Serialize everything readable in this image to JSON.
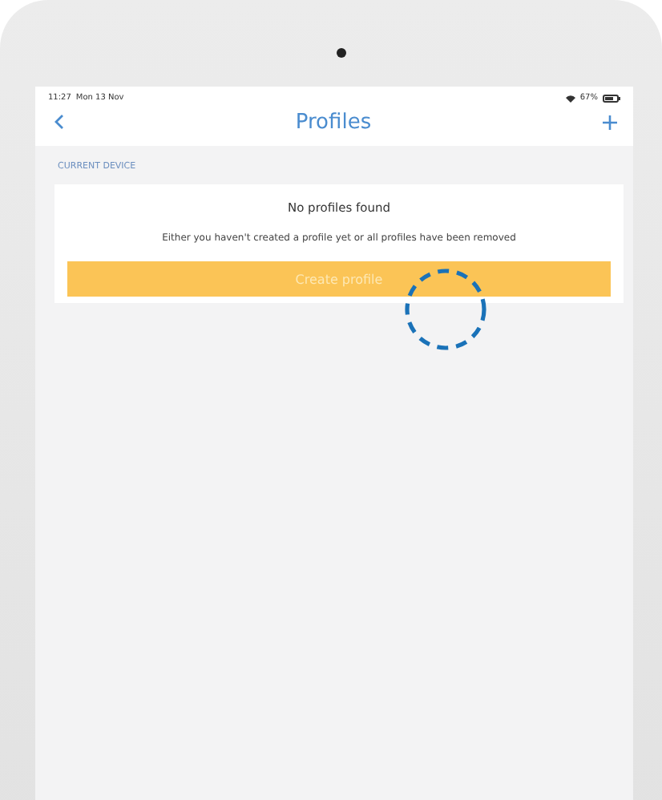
{
  "status_bar": {
    "time": "11:27",
    "date": "Mon 13 Nov",
    "battery": "67%"
  },
  "nav_bar": {
    "title": "Profiles"
  },
  "section_label": "CURRENT DEVICE",
  "empty_card": {
    "title": "No profiles found",
    "message": "Either you haven't created a profile yet or all profiles have been removed",
    "button": "Create profile"
  }
}
